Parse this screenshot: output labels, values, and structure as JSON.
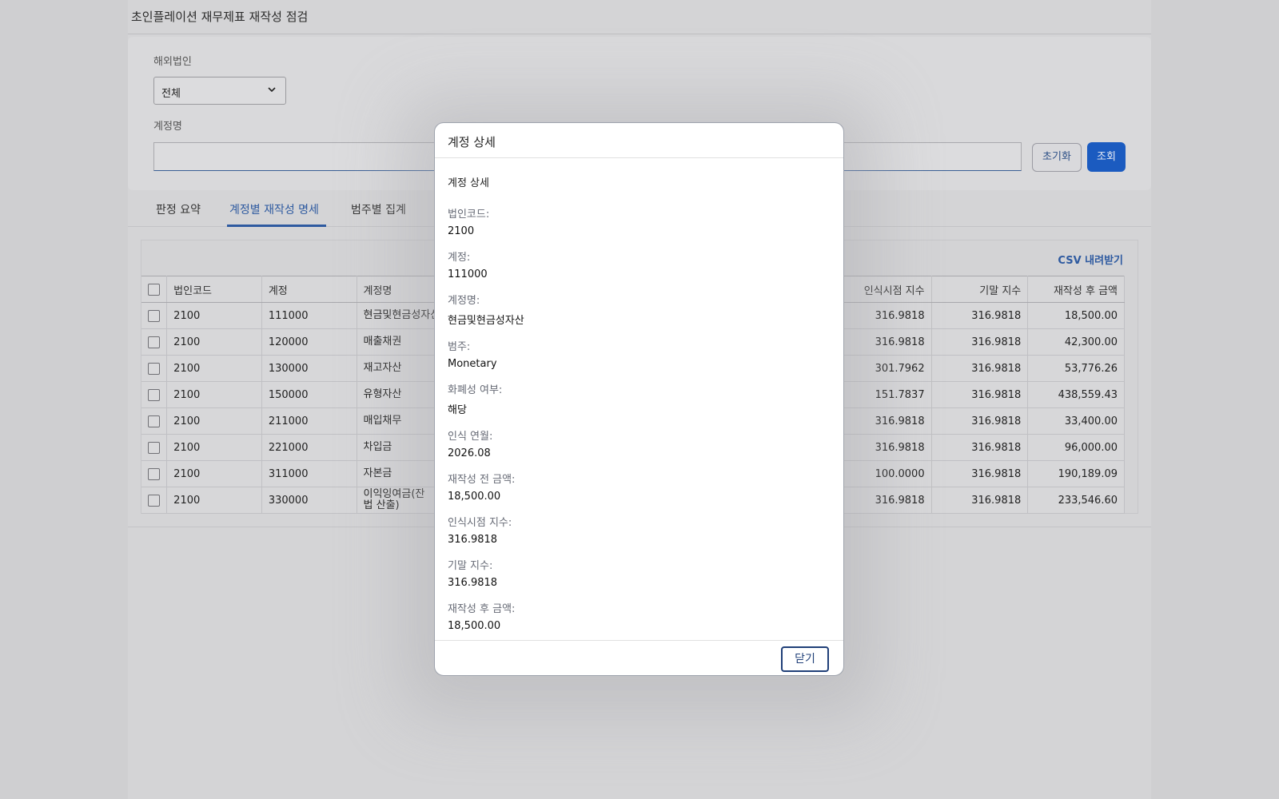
{
  "page": {
    "title": "초인플레이션 재무제표 재작성 점검"
  },
  "filters": {
    "entity_label": "해외법인",
    "entity_value": "전체",
    "account_label": "계정명",
    "account_value": "",
    "reset_label": "초기화",
    "search_label": "조회"
  },
  "tabs": [
    {
      "label": "판정 요약"
    },
    {
      "label": "계정별 재작성 명세"
    },
    {
      "label": "범주별 집계"
    }
  ],
  "table": {
    "csv_label": "CSV 내려받기",
    "headers": {
      "entity_code": "법인코드",
      "account": "계정",
      "account_name": "계정명",
      "recog_index": "인식시점 지수",
      "end_index": "기말 지수",
      "restated_amount": "재작성 후 금액"
    },
    "rows": [
      {
        "entity_code": "2100",
        "account": "111000",
        "account_name": "현금및현금성자산",
        "recog_index": "316.9818",
        "end_index": "316.9818",
        "restated_amount": "18,500.00"
      },
      {
        "entity_code": "2100",
        "account": "120000",
        "account_name": "매출채권",
        "recog_index": "316.9818",
        "end_index": "316.9818",
        "restated_amount": "42,300.00"
      },
      {
        "entity_code": "2100",
        "account": "130000",
        "account_name": "재고자산",
        "recog_index": "301.7962",
        "end_index": "316.9818",
        "restated_amount": "53,776.26"
      },
      {
        "entity_code": "2100",
        "account": "150000",
        "account_name": "유형자산",
        "recog_index": "151.7837",
        "end_index": "316.9818",
        "restated_amount": "438,559.43"
      },
      {
        "entity_code": "2100",
        "account": "211000",
        "account_name": "매입채무",
        "recog_index": "316.9818",
        "end_index": "316.9818",
        "restated_amount": "33,400.00"
      },
      {
        "entity_code": "2100",
        "account": "221000",
        "account_name": "차입금",
        "recog_index": "316.9818",
        "end_index": "316.9818",
        "restated_amount": "96,000.00"
      },
      {
        "entity_code": "2100",
        "account": "311000",
        "account_name": "자본금",
        "recog_index": "100.0000",
        "end_index": "316.9818",
        "restated_amount": "190,189.09"
      },
      {
        "entity_code": "2100",
        "account": "330000",
        "account_name": "이익잉여금(잔\n법 산출)",
        "recog_index": "316.9818",
        "end_index": "316.9818",
        "restated_amount": "233,546.60"
      }
    ]
  },
  "modal": {
    "title": "계정 상세",
    "subtitle": "계정 상세",
    "fields": [
      {
        "label": "법인코드:",
        "value": "2100"
      },
      {
        "label": "계정:",
        "value": "111000"
      },
      {
        "label": "계정명:",
        "value": "현금및현금성자산"
      },
      {
        "label": "범주:",
        "value": "Monetary"
      },
      {
        "label": "화폐성 여부:",
        "value": "해당"
      },
      {
        "label": "인식 연월:",
        "value": "2026.08"
      },
      {
        "label": "재작성 전 금액:",
        "value": "18,500.00"
      },
      {
        "label": "인식시점 지수:",
        "value": "316.9818"
      },
      {
        "label": "기말 지수:",
        "value": "316.9818"
      },
      {
        "label": "재작성 후 금액:",
        "value": "18,500.00"
      }
    ],
    "close_label": "닫기"
  }
}
